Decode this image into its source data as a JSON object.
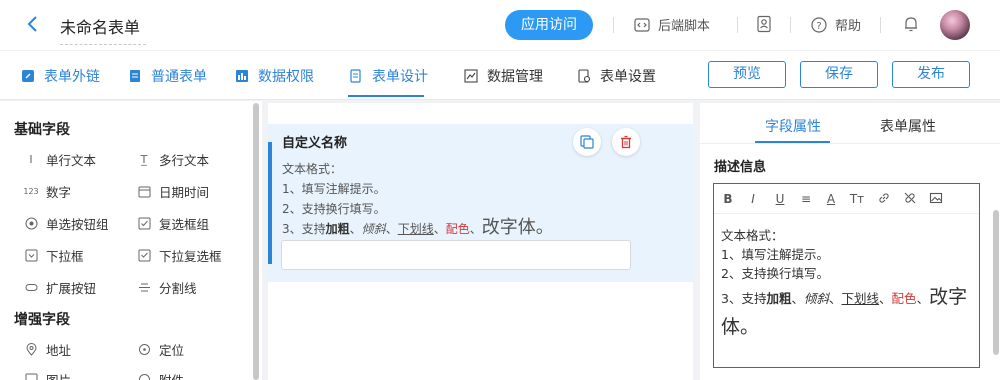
{
  "header": {
    "title": "未命名表单",
    "visit_button": "应用访问",
    "backend_script": "后端脚本",
    "help": "帮助"
  },
  "nav": {
    "items": [
      "表单外链",
      "普通表单",
      "数据权限",
      "表单设计",
      "数据管理",
      "表单设置"
    ],
    "buttons": [
      "预览",
      "保存",
      "发布"
    ]
  },
  "left": {
    "basic_title": "基础字段",
    "basic_fields": [
      "单行文本",
      "多行文本",
      "数字",
      "日期时间",
      "单选按钮组",
      "复选框组",
      "下拉框",
      "下拉复选框",
      "扩展按钮",
      "分割线"
    ],
    "enhanced_title": "增强字段",
    "enhanced_fields": [
      "地址",
      "定位",
      "图片",
      "附件"
    ]
  },
  "card": {
    "title": "自定义名称",
    "line0": "文本格式：",
    "line1": "1、填写注解提示。",
    "line2": "2、支持换行填写。",
    "line3_prefix": "3、支持",
    "bold": "加粗",
    "sep": "、",
    "italic": "倾斜",
    "underline": "下划线",
    "color": "配色",
    "font": "改字体。"
  },
  "right": {
    "tabs": [
      "字段属性",
      "表单属性"
    ],
    "desc_label": "描述信息",
    "toolbar": [
      "B",
      "I",
      "U",
      "≡",
      "A",
      "Tт"
    ]
  },
  "colors": {
    "accent": "#2c84d8",
    "visit": "#2c9af5",
    "danger": "#d03a3a"
  }
}
